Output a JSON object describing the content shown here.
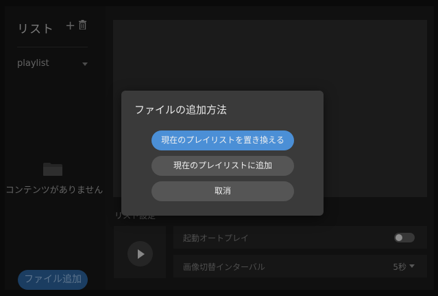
{
  "sidebar": {
    "title": "リスト",
    "add_icon": "plus-icon",
    "delete_icon": "trash-icon",
    "playlist_select": "playlist",
    "empty_icon": "folder-icon",
    "empty_message": "コンテンツがありません",
    "add_file_button": "ファイル追加"
  },
  "main": {
    "settings_section_label": "リスト設定",
    "play_icon": "play-icon",
    "autoplay": {
      "label": "起動オートプレイ",
      "enabled": false
    },
    "interval": {
      "label": "画像切替インターバル",
      "value": "5秒"
    }
  },
  "dialog": {
    "title": "ファイルの追加方法",
    "replace_button": "現在のプレイリストを置き換える",
    "append_button": "現在のプレイリストに追加",
    "cancel_button": "取消"
  },
  "colors": {
    "accent": "#4b8fd6",
    "background": "#1a1a1a",
    "dialog": "#3a3a3a"
  }
}
